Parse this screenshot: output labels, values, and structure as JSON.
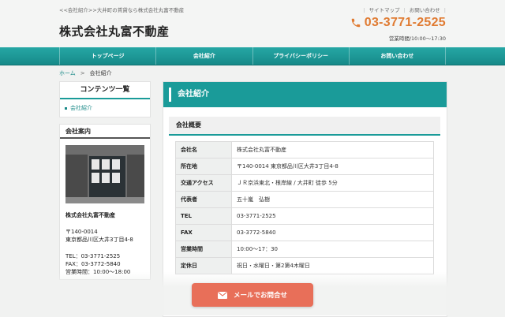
{
  "header": {
    "tagline": "<<会社紹介>>大井町の賃貸なら株式会社丸富不動産",
    "site_title": "株式会社丸富不動産",
    "links": [
      "サイトマップ",
      "お問い合わせ"
    ],
    "phone": "03-3771-2525",
    "hours": "営業時間/10:00〜17:30"
  },
  "nav": [
    "トップページ",
    "会社紹介",
    "プライバシーポリシー",
    "お問い合わせ"
  ],
  "breadcrumb": {
    "home": "ホーム",
    "separator": ">",
    "current": "会社紹介"
  },
  "sidebar": {
    "contents_title": "コンテンツ一覧",
    "contents_items": [
      "会社紹介"
    ],
    "company_title": "会社案内",
    "company_name": "株式会社丸富不動産",
    "postal": "〒140-0014",
    "address": "東京都品川区大井3丁目4-8",
    "tel": "TEL：03-3771-2525",
    "fax": "FAX：03-3772-5840",
    "hours": "営業時間：10:00〜18:00"
  },
  "main": {
    "title": "会社紹介",
    "section_title": "会社概要",
    "rows": [
      {
        "key": "会社名",
        "value": "株式会社丸富不動産"
      },
      {
        "key": "所在地",
        "value": "〒140-0014 東京都品川区大井3丁目4-8"
      },
      {
        "key": "交通アクセス",
        "value": "ＪＲ京浜東北・根岸線 / 大井町 徒歩 5分"
      },
      {
        "key": "代表者",
        "value": "五十嵐　弘樹"
      },
      {
        "key": "TEL",
        "value": "03-3771-2525"
      },
      {
        "key": "FAX",
        "value": "03-3772-5840"
      },
      {
        "key": "営業時間",
        "value": "10:00～17：30"
      },
      {
        "key": "定休日",
        "value": "祝日・水曜日・第2第4木曜日"
      }
    ]
  },
  "cta": {
    "label": "メールでお問合せ"
  },
  "colors": {
    "accent": "#1a9b99",
    "phone": "#e07b32",
    "cta": "#e86f59"
  }
}
